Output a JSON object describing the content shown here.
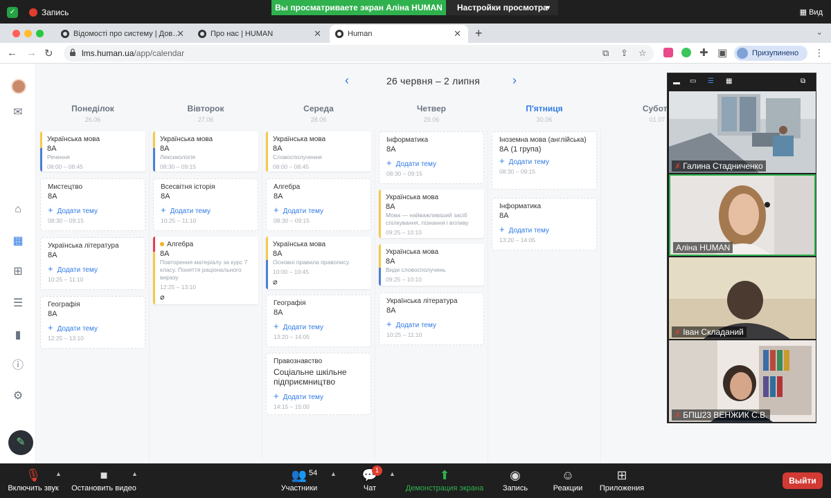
{
  "zoom_top": {
    "recording_label": "Запись",
    "share_banner": "Вы просматриваете экран Аліна HUMAN",
    "view_settings": "Настройки просмотра",
    "view_label": "Вид"
  },
  "browser": {
    "tabs": [
      {
        "label": "Відомості про систему | Дов…"
      },
      {
        "label": "Про нас | HUMAN"
      },
      {
        "label": "Human"
      }
    ],
    "url_host": "lms.human.ua",
    "url_path": "/app/calendar",
    "profile_status": "Призупинено"
  },
  "calendar": {
    "range": "26 червня – 2 липня",
    "days": [
      {
        "name": "Понеділок",
        "date": "26.06"
      },
      {
        "name": "Вівторок",
        "date": "27.06"
      },
      {
        "name": "Середа",
        "date": "28.06"
      },
      {
        "name": "Четвер",
        "date": "29.06"
      },
      {
        "name": "П'ятниця",
        "date": "30.06"
      },
      {
        "name": "Субота",
        "date": "01.07"
      }
    ],
    "add_topic": "Додати тему",
    "cards": {
      "mon1": {
        "subject": "Українська мова",
        "class": "8А",
        "topic": "Речення",
        "time": "08:00 – 08:45"
      },
      "mon2": {
        "subject": "Мистецтво",
        "class": "8А",
        "time": "08:30 – 09:15"
      },
      "mon3": {
        "subject": "Українська література",
        "class": "8А",
        "time": "10:25 – 11:10"
      },
      "mon4": {
        "subject": "Географія",
        "class": "8А",
        "time": "12:25 – 13:10"
      },
      "tue1": {
        "subject": "Українська мова",
        "class": "8А",
        "topic": "Лексикологія",
        "time": "08:30 – 09:15"
      },
      "tue2": {
        "subject": "Всесвітня історія",
        "class": "8А",
        "time": "10:25 – 11:10"
      },
      "tue3": {
        "subject": "Алгебра",
        "class": "8А",
        "topic": "Повторення матеріалу за курс 7 класу. Поняття раціонального виразу",
        "time": "12:25 – 13:10"
      },
      "wed1": {
        "subject": "Українська мова",
        "class": "8А",
        "topic": "Словосполучення",
        "time": "08:00 – 08:45"
      },
      "wed2": {
        "subject": "Алгебра",
        "class": "8А",
        "time": "08:30 – 09:15"
      },
      "wed3": {
        "subject": "Українська мова",
        "class": "8А",
        "topic": "Основні правила правопису",
        "time": "10:00 – 10:45"
      },
      "wed4": {
        "subject": "Географія",
        "class": "8А",
        "time": "13:20 – 14:05"
      },
      "wed5": {
        "subject": "Правознавство",
        "class": "Соціальне шкільне підприємництво",
        "time": "14:15 – 15:00"
      },
      "thu1": {
        "subject": "Інформатика",
        "class": "8А",
        "time": "08:30 – 09:15"
      },
      "thu2": {
        "subject": "Українська мова",
        "class": "8А",
        "topic": "Мова — найважливіший засіб спілкування, пізнання і впливу",
        "time": "09:25 – 10:10"
      },
      "thu3": {
        "subject": "Українська мова",
        "class": "8А",
        "topic": "Види словосполучень",
        "time": "09:25 – 10:10"
      },
      "thu4": {
        "subject": "Українська література",
        "class": "8А",
        "time": "10:25 – 11:10"
      },
      "fri1": {
        "subject": "Іноземна мова (англійська)",
        "class": "8А (1 група)",
        "time": "08:30 – 09:15"
      },
      "fri2": {
        "subject": "Інформатика",
        "class": "8А",
        "time": "13:20 – 14:05"
      }
    }
  },
  "participants": [
    {
      "name": "Галина Стадниченко",
      "muted": true
    },
    {
      "name": "Аліна HUMAN",
      "muted": false
    },
    {
      "name": "Іван Складаний",
      "muted": true
    },
    {
      "name": "БПШ23 ВЕНЖИК С.В.",
      "muted": true
    }
  ],
  "zoom_bar": {
    "mic": "Включить звук",
    "video": "Остановить видео",
    "participants": "Участники",
    "participants_count": "54",
    "chat": "Чат",
    "chat_badge": "1",
    "share": "Демонстрация экрана",
    "record": "Запись",
    "reactions": "Реакции",
    "apps": "Приложения",
    "leave": "Выйти"
  },
  "colors": {
    "accent": "#2f7ae5",
    "card_yellow": "#f2c94c",
    "card_blue": "#4a7fd8",
    "card_red": "#e0414f",
    "zoom_green": "#2fb14e"
  }
}
